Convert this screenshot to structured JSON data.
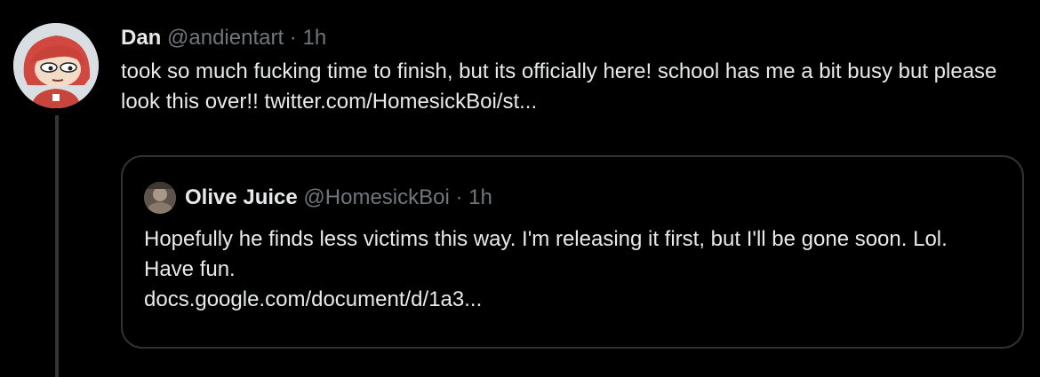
{
  "colors": {
    "background": "#000000",
    "primary_text": "#e7e9ea",
    "secondary_text": "#71767b",
    "border": "#2f3336"
  },
  "tweet": {
    "author_name": "Dan",
    "author_handle": "@andientart",
    "separator": "·",
    "time": "1h",
    "text": "took so much fucking time to finish, but its officially here! school has me a bit busy but please look this over!! ",
    "link": "twitter.com/HomesickBoi/st...",
    "avatar_icon": "cartoon-avatar-red-hair"
  },
  "quoted_tweet": {
    "author_name": "Olive Juice",
    "author_handle": "@HomesickBoi",
    "separator": "·",
    "time": "1h",
    "text": "Hopefully he finds less victims this way. I'm releasing it first, but I'll be gone soon. Lol. Have fun.",
    "link": "docs.google.com/document/d/1a3...",
    "avatar_icon": "photo-avatar"
  }
}
